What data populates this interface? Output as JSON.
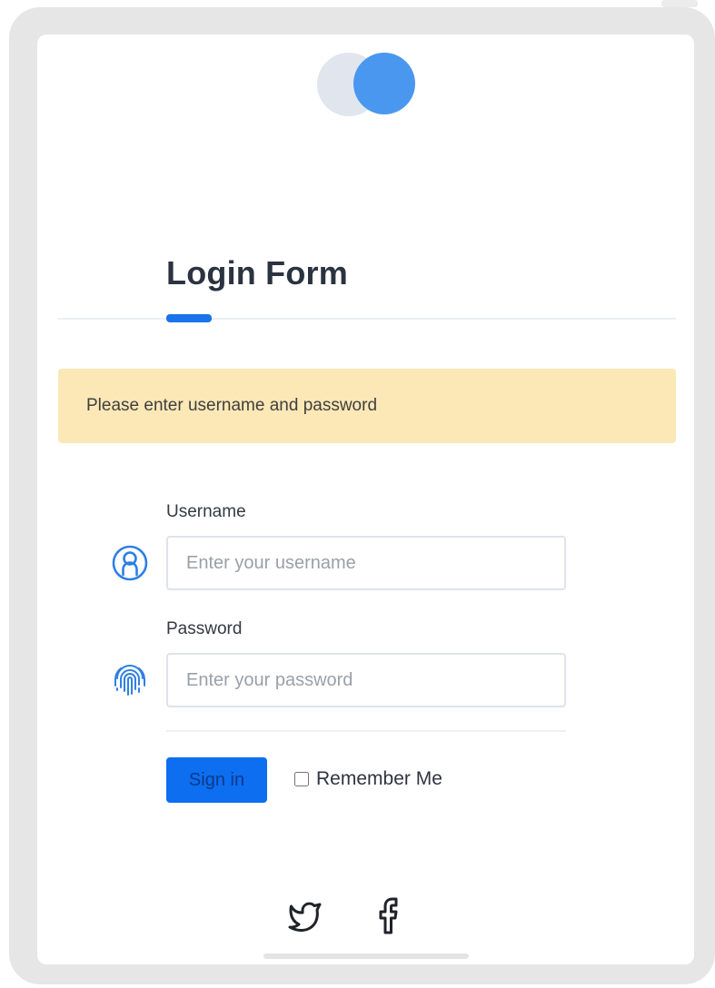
{
  "form": {
    "title": "Login Form",
    "alert_message": "Please enter username and password",
    "username": {
      "label": "Username",
      "placeholder": "Enter your username",
      "value": "",
      "icon": "user-icon"
    },
    "password": {
      "label": "Password",
      "placeholder": "Enter your password",
      "value": "",
      "icon": "fingerprint-icon"
    },
    "submit_label": "Sign in",
    "remember_me": {
      "label": "Remember Me",
      "checked": false
    }
  },
  "social": [
    {
      "name": "twitter",
      "icon": "twitter-icon"
    },
    {
      "name": "facebook",
      "icon": "facebook-icon"
    }
  ],
  "colors": {
    "accent": "#1a73e8",
    "logo_primary": "#4a97ef",
    "logo_secondary": "#e1e6ee",
    "alert_background": "#fbe8b6",
    "title_text": "#2b3340"
  }
}
